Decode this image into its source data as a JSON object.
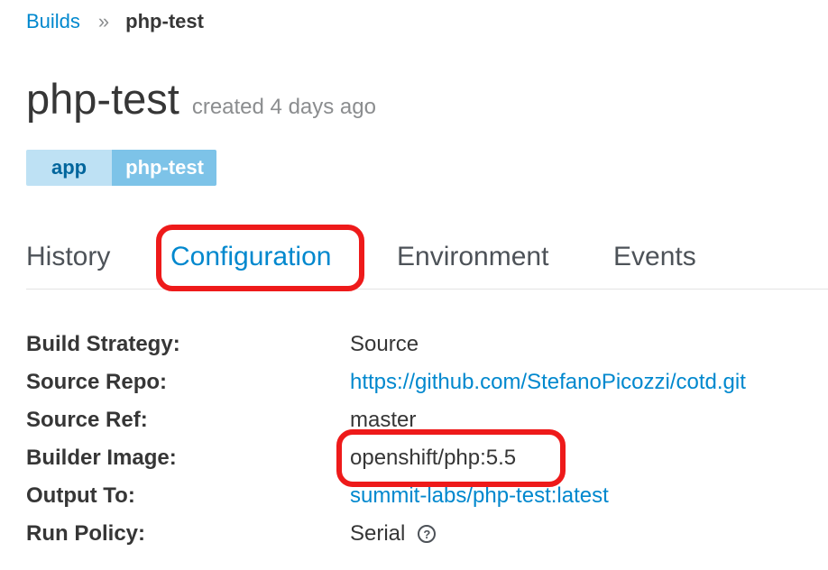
{
  "breadcrumb": {
    "parent": "Builds",
    "separator": "»",
    "current": "php-test"
  },
  "header": {
    "title": "php-test",
    "created": "created 4 days ago"
  },
  "label": {
    "key": "app",
    "value": "php-test"
  },
  "tabs": [
    {
      "label": "History",
      "active": false
    },
    {
      "label": "Configuration",
      "active": true
    },
    {
      "label": "Environment",
      "active": false
    },
    {
      "label": "Events",
      "active": false
    }
  ],
  "details": [
    {
      "label": "Build Strategy:",
      "value": "Source"
    },
    {
      "label": "Source Repo:",
      "value": "https://github.com/StefanoPicozzi/cotd.git"
    },
    {
      "label": "Source Ref:",
      "value": "master"
    },
    {
      "label": "Builder Image:",
      "value": "openshift/php:5.5"
    },
    {
      "label": "Output To:",
      "value": "summit-labs/php-test:latest"
    },
    {
      "label": "Run Policy:",
      "value": "Serial"
    }
  ],
  "icons": {
    "help": "question-circle-icon"
  },
  "colors": {
    "link": "#0088ce",
    "highlight": "#ee1a1a",
    "label_key_bg": "#bee1f4",
    "label_value_bg": "#7dc3e8"
  }
}
